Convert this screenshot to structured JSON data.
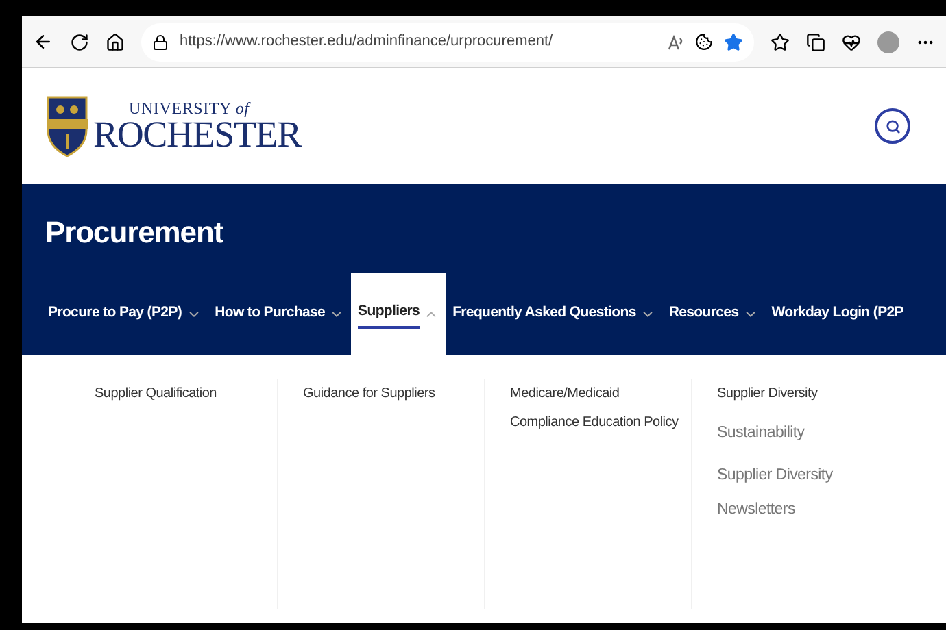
{
  "browser": {
    "url": "https://www.rochester.edu/adminfinance/urprocurement/",
    "favorited": true
  },
  "logo": {
    "line_1": "UNIVERSITY *of*",
    "line_2": "ROCHESTER"
  },
  "site_title": "Procurement",
  "nav": [
    {
      "label": "Procure to Pay (P2P)",
      "caret": true,
      "selected": false
    },
    {
      "label": "How to Purchase",
      "caret": true,
      "selected": false
    },
    {
      "label": "Suppliers",
      "caret": true,
      "selected": true
    },
    {
      "label": "Frequently Asked Questions",
      "caret": true,
      "selected": false
    },
    {
      "label": "Resources",
      "caret": true,
      "selected": false
    },
    {
      "label": "Workday Login (P2P",
      "caret": false,
      "selected": false
    }
  ],
  "dropdown": {
    "columns": [
      {
        "items": [
          {
            "kind": "heading",
            "label": "Supplier Qualification"
          }
        ]
      },
      {
        "items": [
          {
            "kind": "heading",
            "label": "Guidance for Suppliers"
          }
        ]
      },
      {
        "items": [
          {
            "kind": "heading",
            "label": "Medicare/Medicaid Compliance Education Policy"
          }
        ]
      },
      {
        "items": [
          {
            "kind": "heading",
            "label": "Supplier Diversity"
          },
          {
            "kind": "sublink",
            "label": "Sustainability"
          },
          {
            "kind": "sublink",
            "label": "Supplier Diversity Newsletters"
          }
        ]
      }
    ]
  }
}
